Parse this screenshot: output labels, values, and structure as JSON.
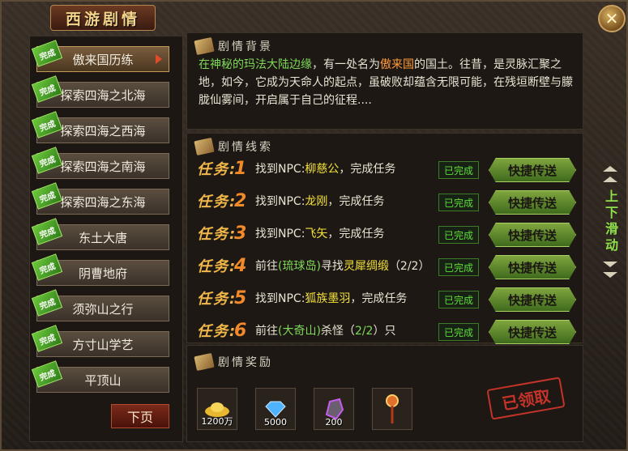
{
  "window": {
    "title": "西游剧情",
    "close_label": "✕"
  },
  "sidebar": {
    "items": [
      {
        "label": "傲来国历练",
        "tag": "完成",
        "active": true
      },
      {
        "label": "探索四海之北海",
        "tag": "完成"
      },
      {
        "label": "探索四海之西海",
        "tag": "完成"
      },
      {
        "label": "探索四海之南海",
        "tag": "完成"
      },
      {
        "label": "探索四海之东海",
        "tag": "完成"
      },
      {
        "label": "东土大唐",
        "tag": "完成"
      },
      {
        "label": "阴曹地府",
        "tag": "完成"
      },
      {
        "label": "须弥山之行",
        "tag": "完成"
      },
      {
        "label": "方寸山学艺",
        "tag": "完成"
      },
      {
        "label": "平顶山",
        "tag": "完成"
      }
    ],
    "next_page": "下页"
  },
  "background": {
    "heading": "剧情背景",
    "p1": "在神秘的玛法大陆边缘",
    "p2": "，有一处名为",
    "p3": "傲来国",
    "p4": "的国土。往昔，是灵脉汇聚之地，如今，它成为天命人的起点，虽破败却蕴含无限可能，在残垣断壁与朦胧仙雾间，开启属于自己的征程...."
  },
  "clues": {
    "heading": "剧情线索",
    "task_label": "任务:",
    "status": "已完成",
    "teleport": "快捷传送",
    "tasks": [
      {
        "num": "1",
        "a": "找到NPC:",
        "b": "柳慈公",
        "c": "，完成任务",
        "d": ""
      },
      {
        "num": "2",
        "a": "找到NPC:",
        "b": "龙刚",
        "c": "，完成任务",
        "d": ""
      },
      {
        "num": "3",
        "a": "找到NPC:",
        "b": "飞矢",
        "c": "，完成任务",
        "d": ""
      },
      {
        "num": "4",
        "a": "前往",
        "b": "(琉球岛)",
        "c": "寻找",
        "d": "灵犀绸缎",
        "e": "（2/2）"
      },
      {
        "num": "5",
        "a": "找到NPC:",
        "b": "狐族墨羽",
        "c": "，完成任务",
        "d": ""
      },
      {
        "num": "6",
        "a": "前往",
        "b": "(大奇山)",
        "c": "杀怪（",
        "d": "2/2",
        "e": "）只"
      }
    ]
  },
  "rewards": {
    "heading": "剧情奖励",
    "items": [
      {
        "icon": "gold-ingot-icon",
        "amount": "1200万"
      },
      {
        "icon": "diamond-icon",
        "amount": "5000"
      },
      {
        "icon": "stone-icon",
        "amount": "200"
      },
      {
        "icon": "staff-icon",
        "amount": ""
      }
    ],
    "stamp": "已领取"
  },
  "scroll_hint": "上下滑动",
  "colors": {
    "accent_green": "#7ed957",
    "accent_orange": "#ff9a3a",
    "task_gold": "#f2b84b"
  }
}
